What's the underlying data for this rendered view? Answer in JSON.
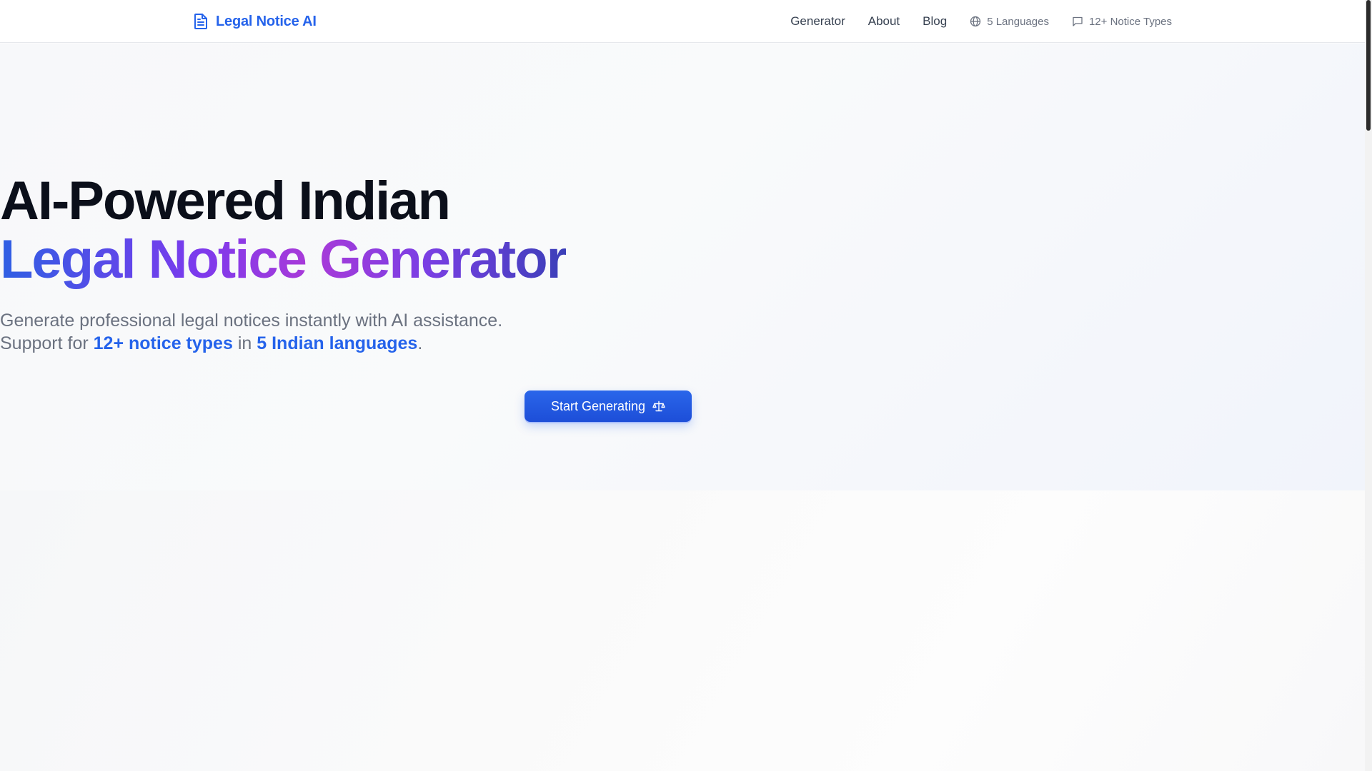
{
  "header": {
    "brand": "Legal Notice AI",
    "nav": [
      {
        "label": "Generator"
      },
      {
        "label": "About"
      },
      {
        "label": "Blog"
      }
    ],
    "meta": [
      {
        "label": "5 Languages",
        "icon": "globe-icon"
      },
      {
        "label": "12+ Notice Types",
        "icon": "message-square-icon"
      }
    ]
  },
  "hero": {
    "title_line1": "AI-Powered Indian",
    "title_line2": "Legal Notice Generator",
    "subtitle_line1": "Generate professional legal notices instantly with AI assistance.",
    "subtitle_prefix": "Support for",
    "subtitle_highlight1": "12+ notice types",
    "subtitle_middle": "in",
    "subtitle_highlight2": "5 Indian languages",
    "subtitle_suffix": ".",
    "cta_label": "Start Generating"
  },
  "colors": {
    "accent": "#2563eb",
    "gradient": [
      "#2f5fe3",
      "#7c3aed",
      "#a93ad8",
      "#3b3fb8"
    ],
    "headline": "#0b0f1a",
    "muted": "#6b7280"
  }
}
